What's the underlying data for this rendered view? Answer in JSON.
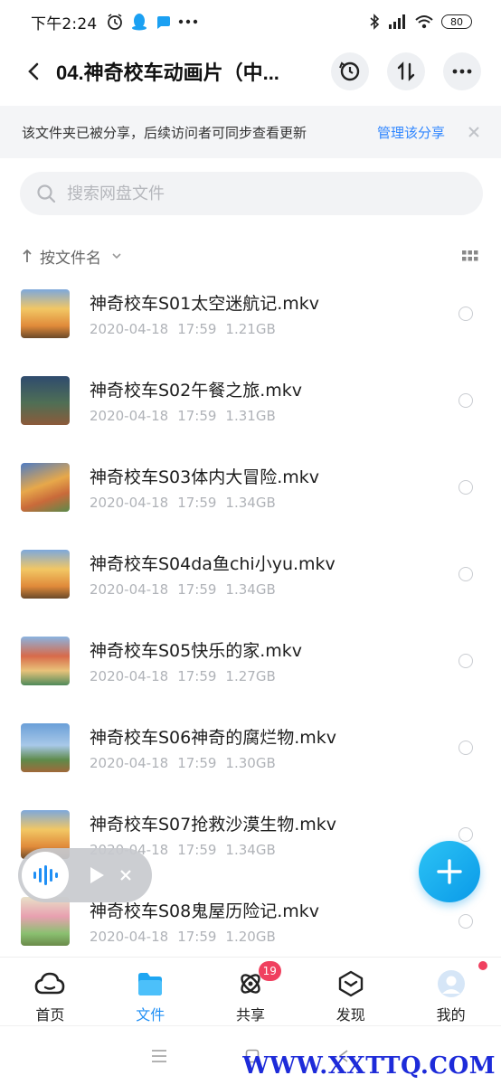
{
  "status_bar": {
    "time": "下午2:24",
    "battery": "80",
    "icons": [
      "alarm-icon",
      "qq-icon",
      "chat-icon",
      "more-dots-icon",
      "bluetooth-icon",
      "signal-icon",
      "wifi-icon",
      "battery-icon"
    ]
  },
  "header": {
    "title": "04.神奇校车动画片（中...",
    "actions": [
      "history-icon",
      "sort-transfer-icon",
      "more-icon"
    ]
  },
  "share_banner": {
    "text": "该文件夹已被分享，后续访问者可同步查看更新",
    "link": "管理该分享"
  },
  "search": {
    "placeholder": "搜索网盘文件"
  },
  "sort": {
    "label": "按文件名"
  },
  "files": [
    {
      "name": "神奇校车S01太空迷航记.mkv",
      "date": "2020-04-18",
      "time": "17:59",
      "size": "1.21GB"
    },
    {
      "name": "神奇校车S02午餐之旅.mkv",
      "date": "2020-04-18",
      "time": "17:59",
      "size": "1.31GB"
    },
    {
      "name": "神奇校车S03体内大冒险.mkv",
      "date": "2020-04-18",
      "time": "17:59",
      "size": "1.34GB"
    },
    {
      "name": "神奇校车S04da鱼chi小yu.mkv",
      "date": "2020-04-18",
      "time": "17:59",
      "size": "1.34GB"
    },
    {
      "name": "神奇校车S05快乐的家.mkv",
      "date": "2020-04-18",
      "time": "17:59",
      "size": "1.27GB"
    },
    {
      "name": "神奇校车S06神奇的腐烂物.mkv",
      "date": "2020-04-18",
      "time": "17:59",
      "size": "1.30GB"
    },
    {
      "name": "神奇校车S07抢救沙漠生物.mkv",
      "date": "2020-04-18",
      "time": "17:59",
      "size": "1.34GB"
    },
    {
      "name": "神奇校车S08鬼屋历险记.mkv",
      "date": "2020-04-18",
      "time": "17:59",
      "size": "1.20GB"
    }
  ],
  "tabs": [
    {
      "label": "首页",
      "icon": "cloud-home-icon",
      "active": false
    },
    {
      "label": "文件",
      "icon": "folder-icon",
      "active": true
    },
    {
      "label": "共享",
      "icon": "share-atom-icon",
      "active": false,
      "badge": "19"
    },
    {
      "label": "发现",
      "icon": "discover-box-icon",
      "active": false
    },
    {
      "label": "我的",
      "icon": "avatar-icon",
      "active": false
    }
  ],
  "watermark": "WWW.XXTTQ.COM",
  "colors": {
    "accent": "#1f8ff5",
    "link": "#2f86ff",
    "badge": "#f0405f",
    "fab": "#14a8ee"
  }
}
